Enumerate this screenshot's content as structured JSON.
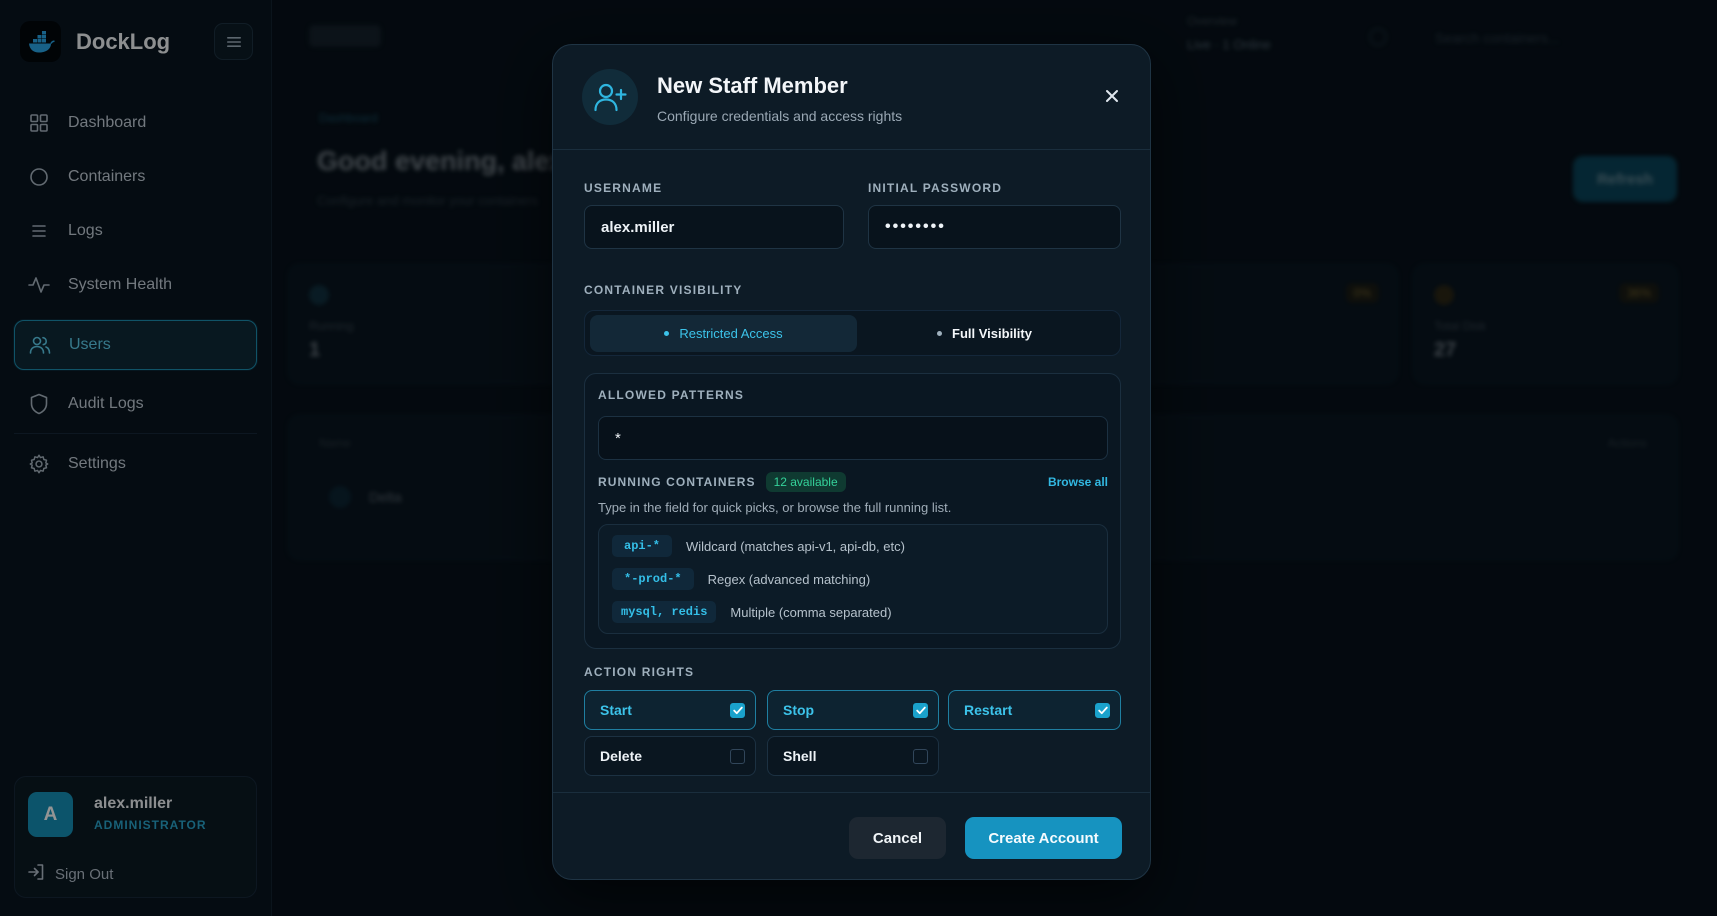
{
  "app": {
    "name": "DockLog"
  },
  "sidebar": {
    "items": [
      {
        "label": "Dashboard",
        "icon": "grid-icon"
      },
      {
        "label": "Containers",
        "icon": "circle-icon"
      },
      {
        "label": "Logs",
        "icon": "list-icon"
      },
      {
        "label": "System Health",
        "icon": "activity-icon"
      },
      {
        "label": "Users",
        "icon": "users-icon",
        "active": true
      },
      {
        "label": "Audit Logs",
        "icon": "shield-icon"
      },
      {
        "label": "Settings",
        "icon": "gear-icon"
      }
    ],
    "user": {
      "initial": "A",
      "name": "alex.miller",
      "role": "ADMINISTRATOR"
    },
    "signout_label": "Sign Out"
  },
  "background": {
    "status_label": "Overview",
    "status_value": "Live · 1 Online",
    "search_placeholder": "Search containers...",
    "section": "Dashboard",
    "greeting": "Good evening, alex",
    "subtitle": "Configure and monitor your containers",
    "refresh_label": "Refresh",
    "cards": [
      {
        "label": "Running",
        "value": "1",
        "badge": ""
      },
      {
        "label": "",
        "value": "",
        "badge": "0%"
      },
      {
        "label": "Total Disk",
        "value": "27",
        "badge": "36%"
      }
    ],
    "table_head": "Name",
    "table_head_right": "Actions",
    "row_name": "Delta"
  },
  "modal": {
    "title": "New Staff Member",
    "subtitle": "Configure credentials and access rights",
    "username_label": "USERNAME",
    "username_value": "alex.miller",
    "password_label": "INITIAL PASSWORD",
    "password_value": "••••••••",
    "visibility_label": "CONTAINER VISIBILITY",
    "visibility_options": {
      "restricted": "Restricted Access",
      "full": "Full Visibility"
    },
    "visibility_selected": "restricted",
    "patterns_label": "ALLOWED PATTERNS",
    "patterns_value": "*",
    "running_label": "RUNNING CONTAINERS",
    "available_badge": "12 available",
    "browse_all": "Browse all",
    "hint": "Type in the field for quick picks, or browse the full running list.",
    "examples": [
      {
        "code": "api-*",
        "desc": "Wildcard (matches api-v1, api-db, etc)"
      },
      {
        "code": "*-prod-*",
        "desc": "Regex (advanced matching)"
      },
      {
        "code": "mysql, redis",
        "desc": "Multiple (comma separated)"
      }
    ],
    "rights_label": "ACTION RIGHTS",
    "rights": [
      {
        "label": "Start",
        "checked": true
      },
      {
        "label": "Stop",
        "checked": true
      },
      {
        "label": "Restart",
        "checked": true
      },
      {
        "label": "Delete",
        "checked": false
      },
      {
        "label": "Shell",
        "checked": false
      }
    ],
    "cancel_label": "Cancel",
    "create_label": "Create Account"
  },
  "colors": {
    "accent": "#1693c0",
    "accent_text": "#3cc3ea",
    "success": "#35d29a",
    "background": "#07111a",
    "panel": "#0d1b26"
  }
}
